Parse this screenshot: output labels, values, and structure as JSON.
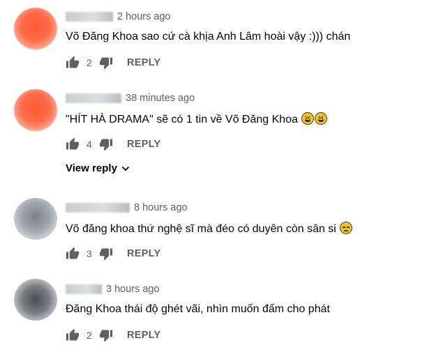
{
  "comments": [
    {
      "time": "2 hours ago",
      "text": "Võ Đăng Khoa sao cứ cà khịa Anh Lâm hoài vậy :))) chán",
      "likes": "2",
      "reply_label": "REPLY"
    },
    {
      "time": "38 minutes ago",
      "text": "\"HÍT HÀ DRAMA\" sẽ có 1 tin về Võ Đăng Khoa",
      "likes": "4",
      "reply_label": "REPLY",
      "view_reply_label": "View reply"
    },
    {
      "time": "8 hours ago",
      "text": "Võ đăng khoa thứ nghệ sĩ mà đéo có duyên còn sân si",
      "likes": "3",
      "reply_label": "REPLY"
    },
    {
      "time": "3 hours ago",
      "text": "Đăng Khoa thái độ ghét vãi, nhìn muốn đấm cho phát",
      "likes": "2",
      "reply_label": "REPLY"
    }
  ],
  "icons": {
    "like": "thumb-up-icon",
    "dislike": "thumb-down-icon",
    "expand": "chevron-down-icon",
    "emoji_laugh": "laughing-emoji",
    "emoji_unamused": "unamused-emoji"
  },
  "colors": {
    "text": "#030303",
    "secondary": "#606060",
    "background": "#ffffff"
  }
}
